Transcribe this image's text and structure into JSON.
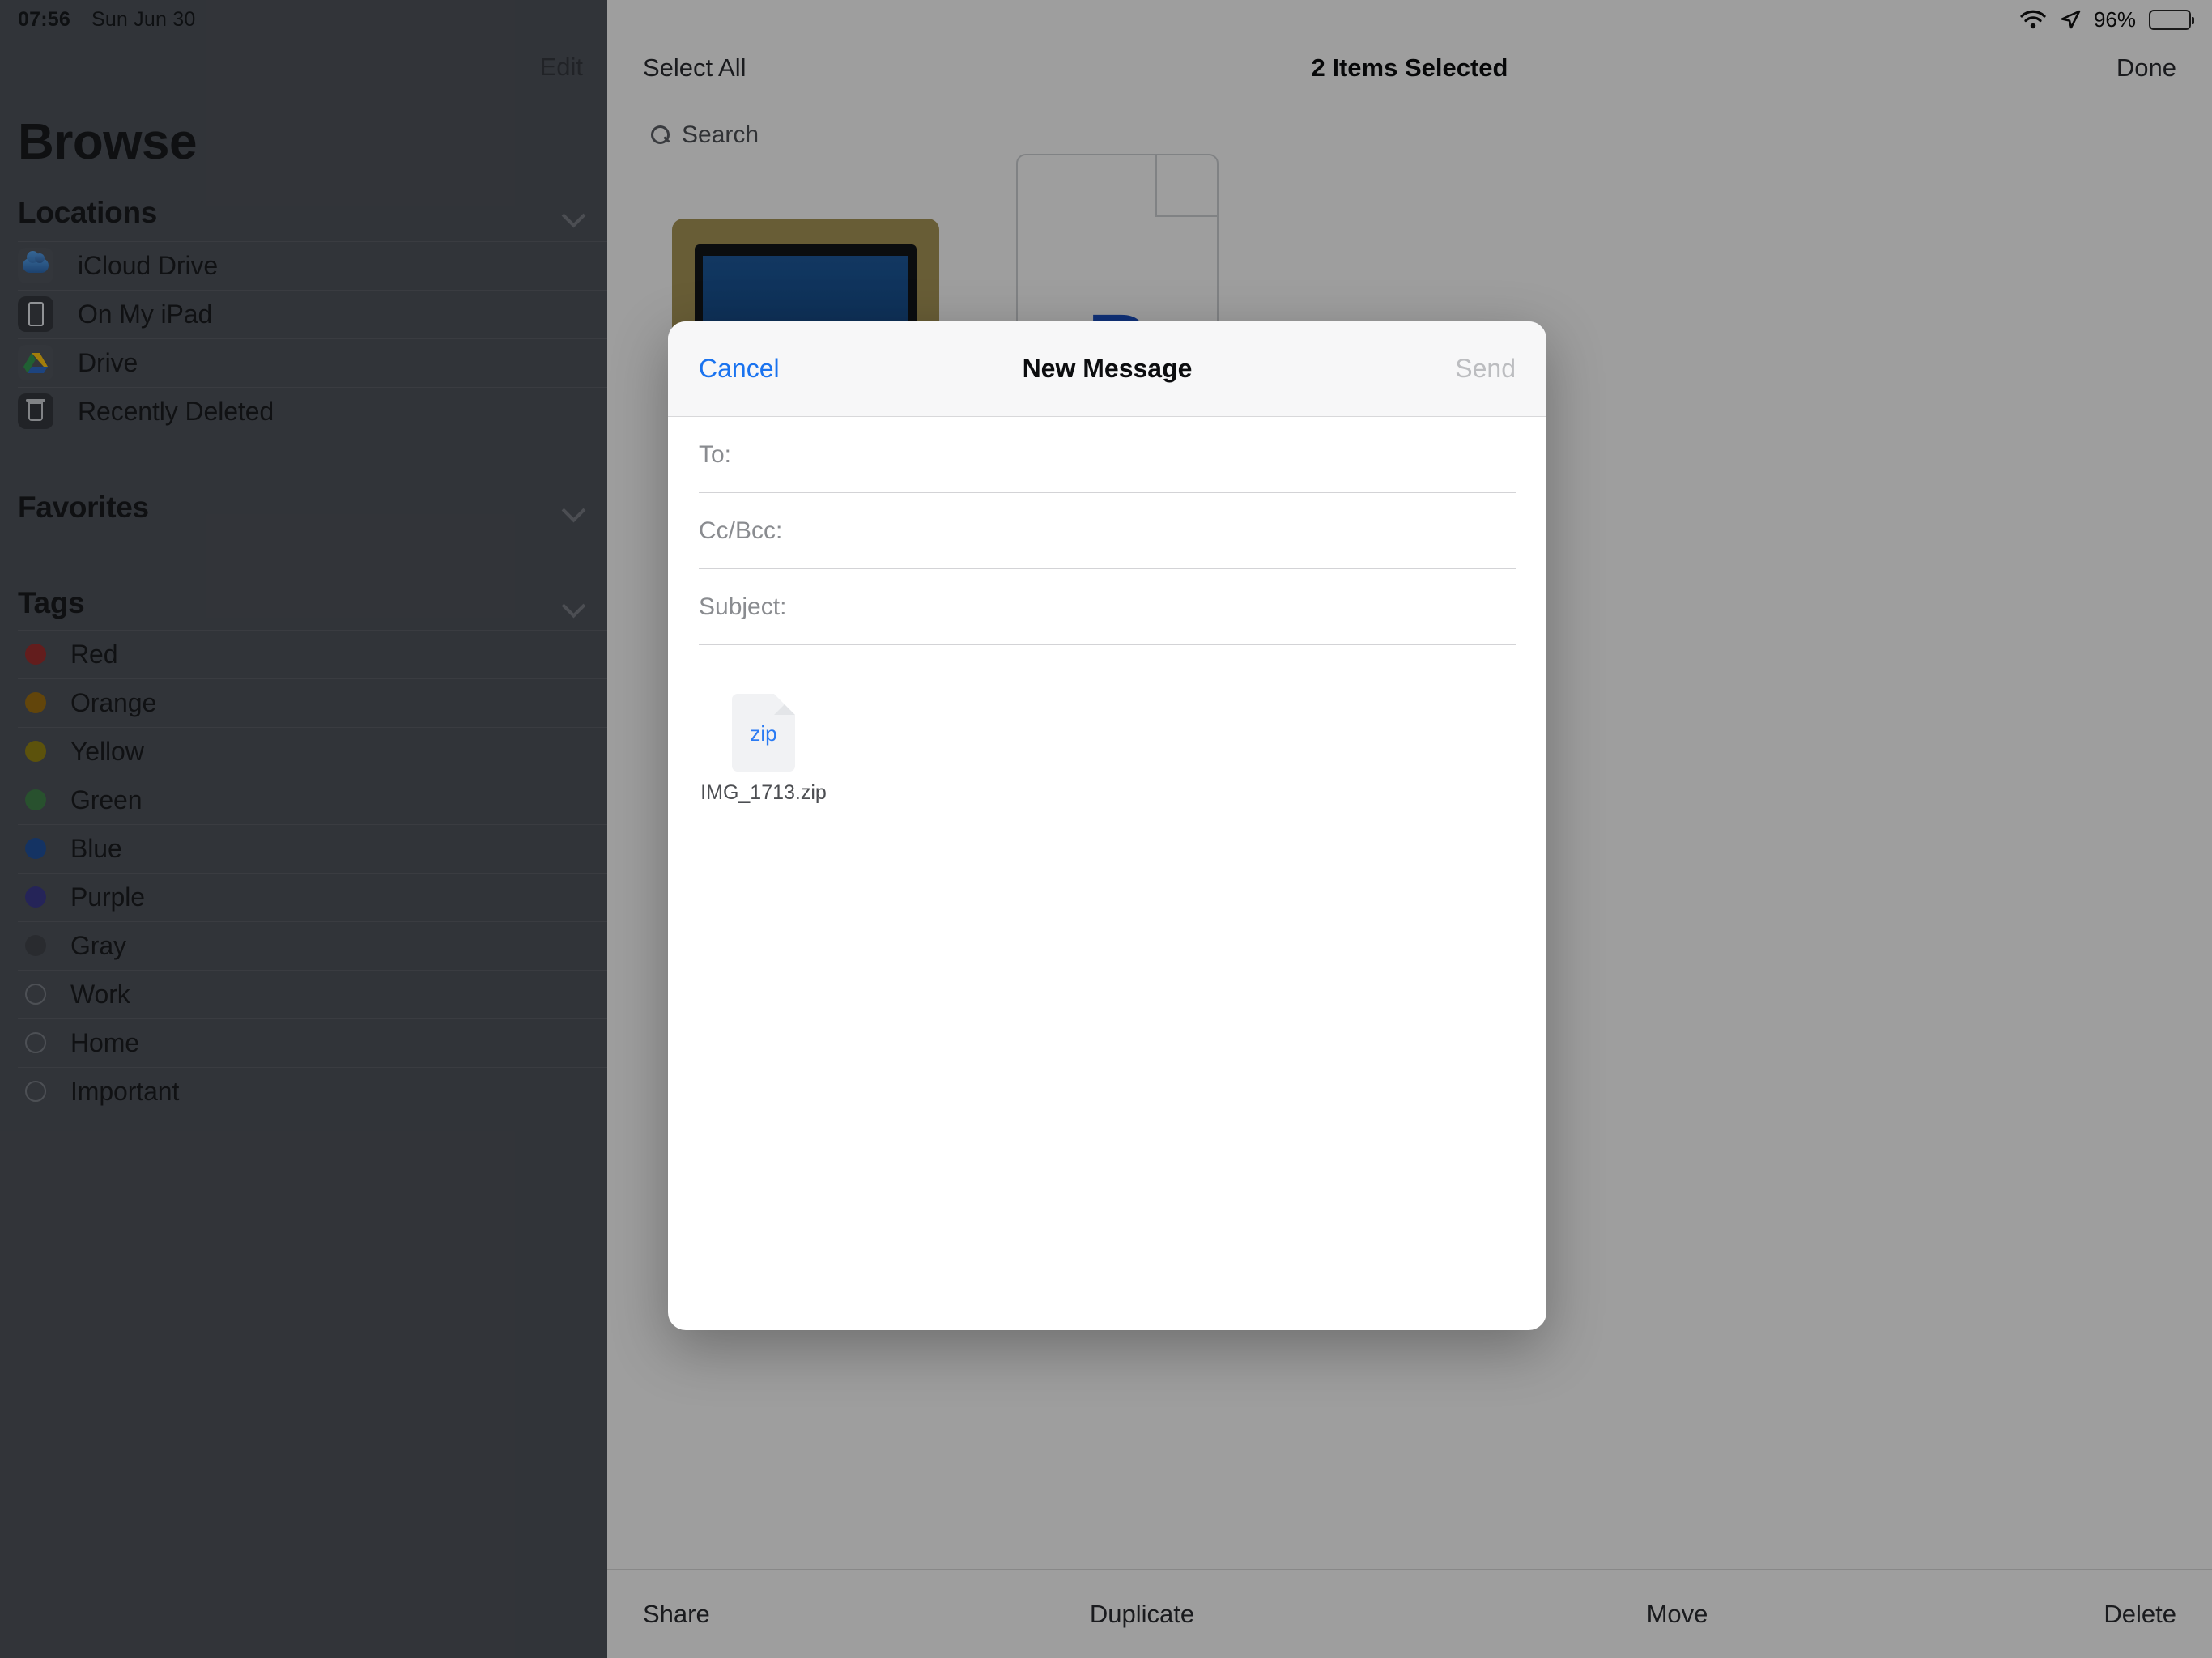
{
  "status_bar": {
    "time": "07:56",
    "date": "Sun Jun 30",
    "battery_percent": "96%",
    "wifi_icon": "wifi-icon",
    "location_icon": "location-arrow-icon",
    "battery_icon": "battery-icon"
  },
  "sidebar": {
    "edit_label": "Edit",
    "title": "Browse",
    "sections": [
      {
        "title": "Locations",
        "chevron": "chevron-down-icon",
        "items": [
          {
            "label": "iCloud Drive",
            "icon": "icloud-drive-icon"
          },
          {
            "label": "On My iPad",
            "icon": "ipad-device-icon"
          },
          {
            "label": "Drive",
            "icon": "google-drive-icon"
          },
          {
            "label": "Recently Deleted",
            "icon": "trash-icon"
          }
        ]
      },
      {
        "title": "Favorites",
        "chevron": "chevron-down-icon",
        "items": []
      },
      {
        "title": "Tags",
        "chevron": "chevron-down-icon",
        "items": [
          {
            "label": "Red",
            "icon": "tag-dot-icon",
            "color": "#8e2a2a",
            "filled": true
          },
          {
            "label": "Orange",
            "icon": "tag-dot-icon",
            "color": "#8d6310",
            "filled": true
          },
          {
            "label": "Yellow",
            "icon": "tag-dot-icon",
            "color": "#857612",
            "filled": true
          },
          {
            "label": "Green",
            "icon": "tag-dot-icon",
            "color": "#3a7542",
            "filled": true
          },
          {
            "label": "Blue",
            "icon": "tag-dot-icon",
            "color": "#1d4a8e",
            "filled": true
          },
          {
            "label": "Purple",
            "icon": "tag-dot-icon",
            "color": "#36347e",
            "filled": true
          },
          {
            "label": "Gray",
            "icon": "tag-dot-icon",
            "color": "#3b3e44",
            "filled": true
          },
          {
            "label": "Work",
            "icon": "tag-circle-outline-icon",
            "color": "#6f737a",
            "filled": false
          },
          {
            "label": "Home",
            "icon": "tag-circle-outline-icon",
            "color": "#6f737a",
            "filled": false
          },
          {
            "label": "Important",
            "icon": "tag-circle-outline-icon",
            "color": "#6f737a",
            "filled": false
          }
        ]
      }
    ]
  },
  "main": {
    "toolbar": {
      "select_all_label": "Select All",
      "title": "2 Items Selected",
      "done_label": "Done"
    },
    "search": {
      "placeholder": "Search",
      "value": "",
      "icon": "search-icon"
    },
    "files": [
      {
        "type": "photo",
        "icon": "photo-thumbnail"
      },
      {
        "type": "document",
        "icon": "document-icon",
        "glyph": "P"
      }
    ],
    "bottom_toolbar": [
      {
        "label": "Share"
      },
      {
        "label": "Duplicate"
      },
      {
        "label": "Move"
      },
      {
        "label": "Delete"
      }
    ]
  },
  "modal": {
    "cancel_label": "Cancel",
    "title": "New Message",
    "send_label": "Send",
    "fields": [
      {
        "label": "To:",
        "value": ""
      },
      {
        "label": "Cc/Bcc:",
        "value": ""
      },
      {
        "label": "Subject:",
        "value": ""
      }
    ],
    "attachment": {
      "filename": "IMG_1713.zip",
      "type_label": "zip",
      "icon": "zip-file-icon"
    },
    "body_text": ""
  },
  "colors": {
    "accent_blue": "#1a73ef",
    "zip_blue": "#2b7bf3",
    "sidebar_bg": "#474b52",
    "modal_bg": "#ffffff",
    "disabled_gray": "#bcbdc0"
  }
}
